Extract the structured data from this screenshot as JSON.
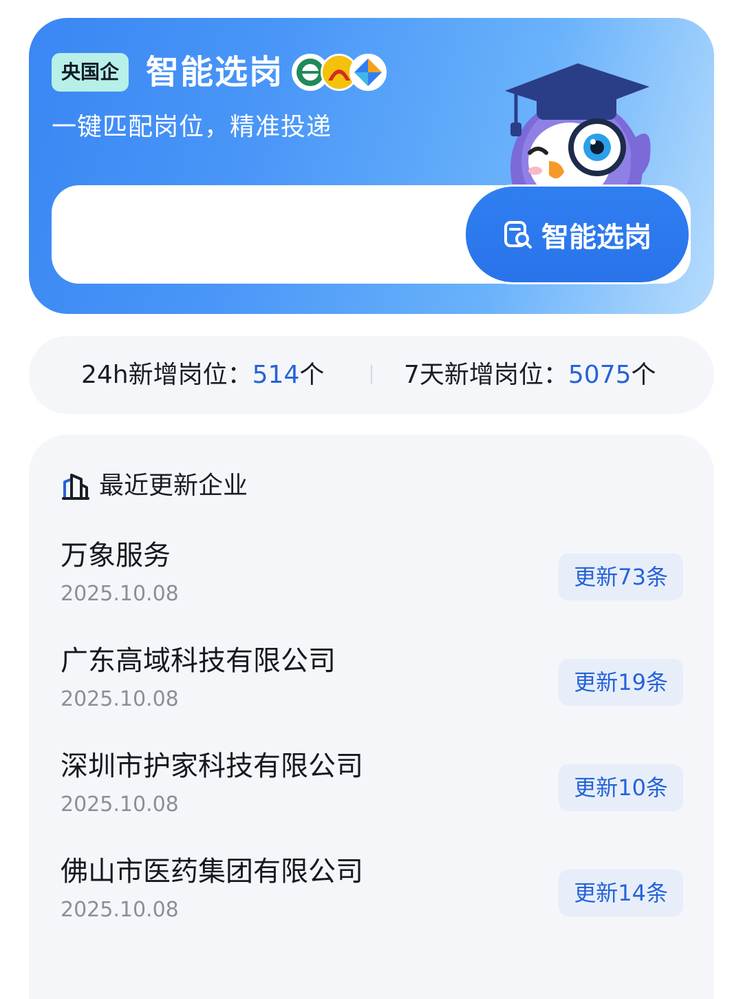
{
  "banner": {
    "tag": "央国企",
    "title": "智能选岗",
    "subtitle": "一键匹配岗位，精准投递",
    "search_button_label": "智能选岗",
    "colors": {
      "gradient_start": "#3a86f3",
      "gradient_end": "#b6dcfd",
      "tag_bg": "#b7f0e8",
      "button_bg": "#2f7ff1"
    }
  },
  "stats": {
    "new_24h_label": "24h新增岗位：",
    "new_24h_value": "514",
    "new_24h_unit": "个",
    "new_7d_label": "7天新增岗位：",
    "new_7d_value": "5075",
    "new_7d_unit": "个",
    "accent_color": "#2563d8"
  },
  "recent": {
    "title": "最近更新企业",
    "icon": "building-icon",
    "companies": [
      {
        "name": "万象服务",
        "date": "2025.10.08",
        "badge": "更新73条"
      },
      {
        "name": "广东高域科技有限公司",
        "date": "2025.10.08",
        "badge": "更新19条"
      },
      {
        "name": "深圳市护家科技有限公司",
        "date": "2025.10.08",
        "badge": "更新10条"
      },
      {
        "name": "佛山市医药集团有限公司",
        "date": "2025.10.08",
        "badge": "更新14条"
      }
    ]
  }
}
